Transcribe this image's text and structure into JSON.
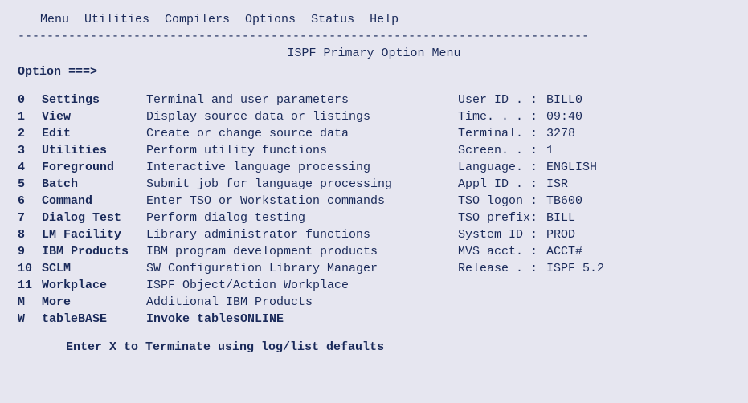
{
  "menubar": [
    "Menu",
    "Utilities",
    "Compilers",
    "Options",
    "Status",
    "Help"
  ],
  "title": "ISPF Primary Option Menu",
  "option_prompt": "Option ===>",
  "option_value": "",
  "options": [
    {
      "num": "0",
      "name": "Settings",
      "desc": "Terminal and user parameters",
      "bold": false
    },
    {
      "num": "1",
      "name": "View",
      "desc": "Display source data or listings",
      "bold": false
    },
    {
      "num": "2",
      "name": "Edit",
      "desc": "Create or change source data",
      "bold": false
    },
    {
      "num": "3",
      "name": "Utilities",
      "desc": "Perform utility functions",
      "bold": false
    },
    {
      "num": "4",
      "name": "Foreground",
      "desc": "Interactive language processing",
      "bold": false
    },
    {
      "num": "5",
      "name": "Batch",
      "desc": "Submit job for language processing",
      "bold": false
    },
    {
      "num": "6",
      "name": "Command",
      "desc": "Enter TSO or Workstation commands",
      "bold": false
    },
    {
      "num": "7",
      "name": "Dialog Test",
      "desc": "Perform dialog testing",
      "bold": false
    },
    {
      "num": "8",
      "name": "LM Facility",
      "desc": "Library administrator functions",
      "bold": false
    },
    {
      "num": "9",
      "name": "IBM Products",
      "desc": "IBM program development products",
      "bold": false
    },
    {
      "num": "10",
      "name": "SCLM",
      "desc": "SW Configuration Library Manager",
      "bold": false
    },
    {
      "num": "11",
      "name": "Workplace",
      "desc": "ISPF Object/Action Workplace",
      "bold": false
    },
    {
      "num": "M",
      "name": "More",
      "desc": "Additional IBM Products",
      "bold": false
    },
    {
      "num": "W",
      "name": "tableBASE",
      "desc": "Invoke tablesONLINE",
      "bold": true
    }
  ],
  "info": [
    {
      "label": "User ID . :",
      "value": "BILL0"
    },
    {
      "label": "Time. . . :",
      "value": "09:40"
    },
    {
      "label": "Terminal. :",
      "value": "3278"
    },
    {
      "label": "Screen. . :",
      "value": "1"
    },
    {
      "label": "Language. :",
      "value": "ENGLISH"
    },
    {
      "label": "Appl ID . :",
      "value": "ISR"
    },
    {
      "label": "TSO logon :",
      "value": "TB600"
    },
    {
      "label": "TSO prefix:",
      "value": "BILL"
    },
    {
      "label": "System ID :",
      "value": "PROD"
    },
    {
      "label": "MVS acct. :",
      "value": "ACCT#"
    },
    {
      "label": "Release . :",
      "value": "ISPF 5.2"
    }
  ],
  "footer": "Enter X to Terminate using log/list defaults",
  "rule": "-------------------------------------------------------------------------------"
}
